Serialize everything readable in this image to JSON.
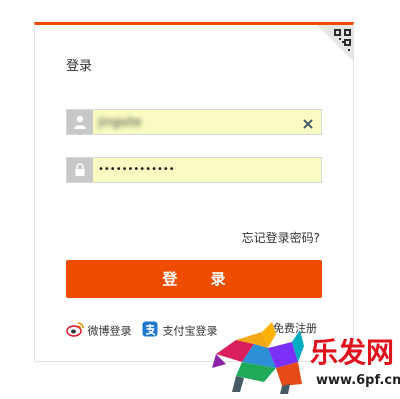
{
  "login": {
    "title": "登录",
    "username_value": "jingsite",
    "password_value": "•••••••••••••",
    "forgot_label": "忘记登录密码?",
    "login_button": "登 录",
    "weibo_label": "微博登录",
    "alipay_label": "支付宝登录",
    "register_label": "免费注册"
  },
  "watermark": {
    "brand": "乐发网",
    "url": "www.6pf.cn"
  },
  "colors": {
    "accent": "#f04c00",
    "field_bg": "#f9fbc2",
    "icon_bg": "#c8c8c8"
  },
  "icons": [
    "qr-code-icon",
    "user-icon",
    "lock-icon",
    "clear-icon",
    "weibo-icon",
    "alipay-icon"
  ]
}
